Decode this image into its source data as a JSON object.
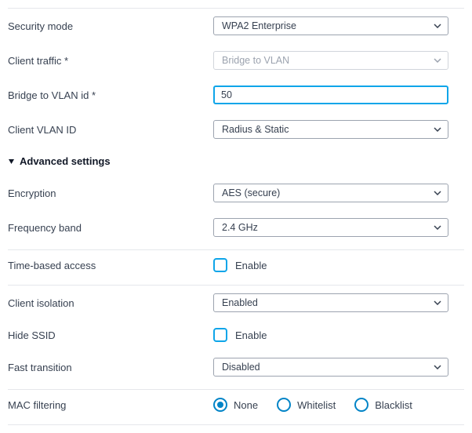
{
  "fields": {
    "security_mode": {
      "label": "Security mode",
      "value": "WPA2 Enterprise"
    },
    "client_traffic": {
      "label": "Client traffic *",
      "value": "Bridge to VLAN"
    },
    "bridge_vlan_id": {
      "label": "Bridge to VLAN id *",
      "value": "50"
    },
    "client_vlan_id": {
      "label": "Client VLAN ID",
      "value": "Radius & Static"
    },
    "advanced_header": "Advanced settings",
    "encryption": {
      "label": "Encryption",
      "value": "AES (secure)"
    },
    "frequency_band": {
      "label": "Frequency band",
      "value": "2.4 GHz"
    },
    "time_based_access": {
      "label": "Time-based access",
      "option": "Enable",
      "checked": false
    },
    "client_isolation": {
      "label": "Client isolation",
      "value": "Enabled"
    },
    "hide_ssid": {
      "label": "Hide SSID",
      "option": "Enable",
      "checked": false
    },
    "fast_transition": {
      "label": "Fast transition",
      "value": "Disabled"
    },
    "mac_filtering": {
      "label": "MAC filtering",
      "options": [
        {
          "label": "None",
          "selected": true
        },
        {
          "label": "Whitelist",
          "selected": false
        },
        {
          "label": "Blacklist",
          "selected": false
        }
      ]
    }
  },
  "colors": {
    "accent": "#0ea5e9",
    "radio": "#0284c7",
    "border": "#9ca3af",
    "text": "#374151"
  }
}
